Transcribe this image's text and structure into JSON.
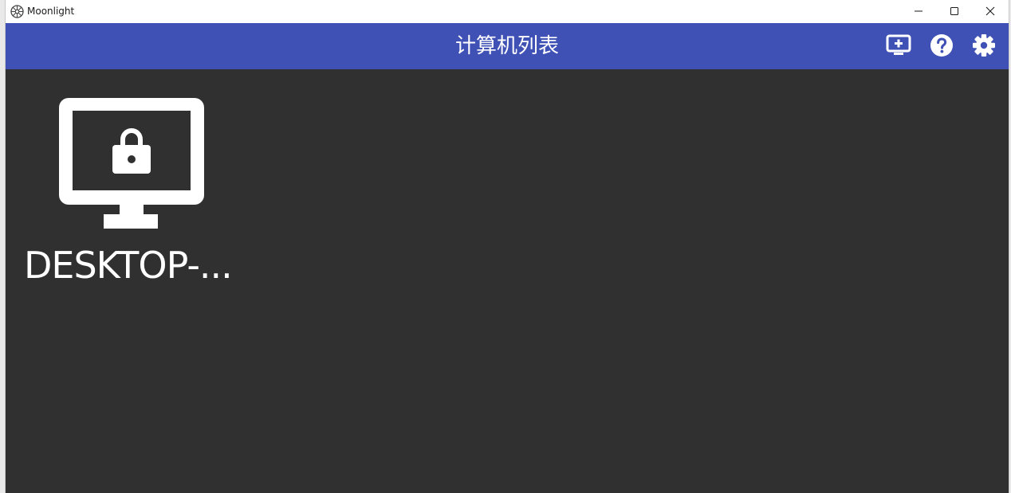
{
  "window": {
    "title": "Moonlight",
    "app_icon": "moonlight-logo-icon",
    "controls": {
      "minimize": "minimize-icon",
      "maximize": "maximize-icon",
      "close": "close-icon"
    }
  },
  "appbar": {
    "title": "计算机列表",
    "background": "#3f51b5",
    "actions": [
      {
        "icon": "add-pc-icon"
      },
      {
        "icon": "help-icon"
      },
      {
        "icon": "gear-icon"
      }
    ]
  },
  "content": {
    "background": "#303030",
    "computers": [
      {
        "name": "DESKTOP-...",
        "icon": "locked-monitor-icon",
        "status": "locked"
      }
    ]
  }
}
